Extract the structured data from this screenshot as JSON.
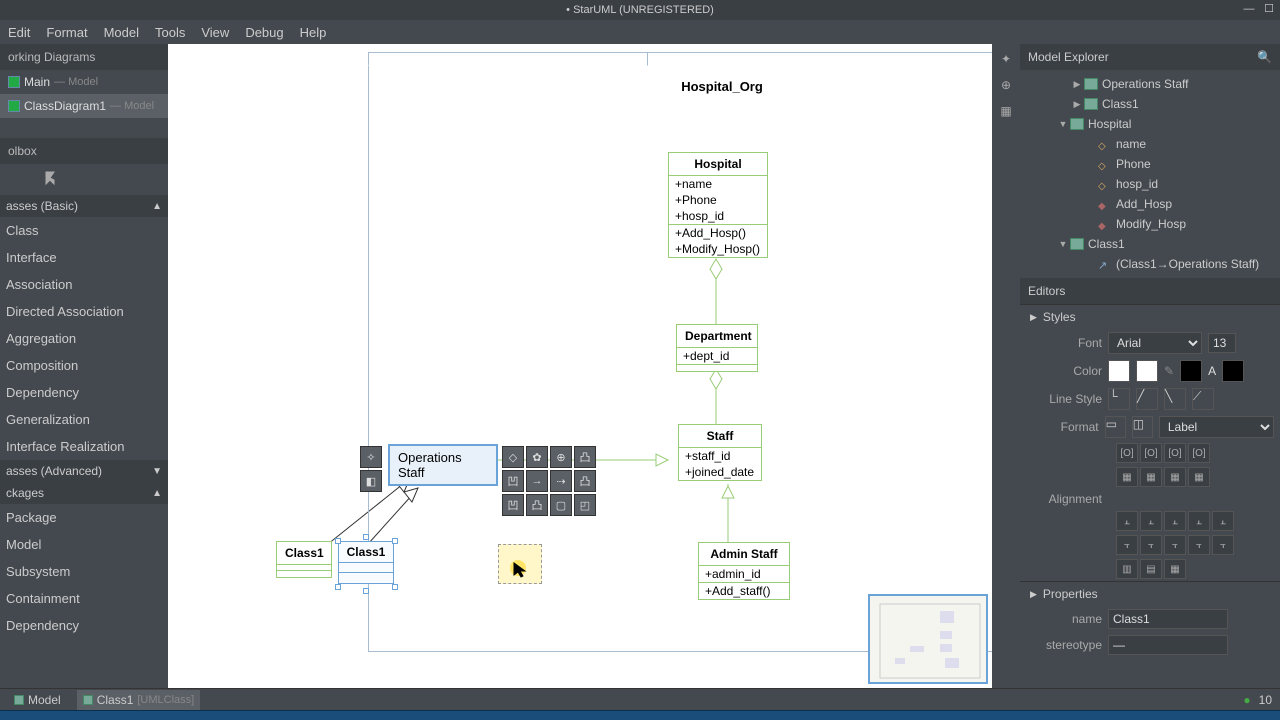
{
  "window": {
    "title": "• StarUML (UNREGISTERED)"
  },
  "menu": {
    "edit": "Edit",
    "format": "Format",
    "model": "Model",
    "tools": "Tools",
    "view": "View",
    "debug": "Debug",
    "help": "Help"
  },
  "working_diagrams": {
    "header": "orking Diagrams",
    "items": [
      {
        "name": "Main",
        "suffix": "— Model"
      },
      {
        "name": "ClassDiagram1",
        "suffix": "— Model"
      }
    ]
  },
  "toolbox": {
    "header": "olbox",
    "sections": {
      "basic": {
        "label": "asses (Basic)",
        "items": [
          "Class",
          "Interface",
          "Association",
          "Directed Association",
          "Aggregation",
          "Composition",
          "Dependency",
          "Generalization",
          "Interface Realization"
        ]
      },
      "advanced": {
        "label": "asses (Advanced)"
      },
      "packages": {
        "label": "ckages",
        "items": [
          "Package",
          "Model",
          "Subsystem",
          "Containment",
          "Dependency"
        ]
      }
    }
  },
  "diagram": {
    "package_name": "Hospital_Org",
    "hospital": {
      "name": "Hospital",
      "attrs": [
        "+name",
        "+Phone",
        "+hosp_id"
      ],
      "ops": [
        "+Add_Hosp()",
        "+Modify_Hosp()"
      ]
    },
    "department": {
      "name": "Department",
      "attrs": [
        "+dept_id"
      ]
    },
    "staff": {
      "name": "Staff",
      "attrs": [
        "+staff_id",
        "+joined_date"
      ]
    },
    "admin_staff": {
      "name": "Admin Staff",
      "attrs": [
        "+admin_id"
      ],
      "ops": [
        "+Add_staff()"
      ]
    },
    "operations_staff": {
      "name": "Operations Staff"
    },
    "class1_a": {
      "name": "Class1"
    },
    "class1_b": {
      "name": "Class1"
    }
  },
  "model_explorer": {
    "header": "Model Explorer",
    "nodes": {
      "n0": "Operations Staff",
      "n1": "Class1",
      "n2": "Hospital",
      "n3": "name",
      "n4": "Phone",
      "n5": "hosp_id",
      "n6": "Add_Hosp",
      "n7": "Modify_Hosp",
      "n8": "Class1",
      "n9": "(Class1→Operations Staff)"
    }
  },
  "editors": {
    "header": "Editors",
    "styles_label": "Styles",
    "font_label": "Font",
    "font_value": "Arial",
    "font_size": "13",
    "color_label": "Color",
    "line_style_label": "Line Style",
    "format_label": "Format",
    "label_value": "Label",
    "alignment_label": "Alignment",
    "properties_label": "Properties",
    "name_label": "name",
    "name_value": "Class1",
    "stereotype_label": "stereotype",
    "stereotype_value": "—"
  },
  "status": {
    "tab1": "Model",
    "tab2": "Class1",
    "tab2_suffix": "[UMLClass]",
    "zoom": "10"
  }
}
